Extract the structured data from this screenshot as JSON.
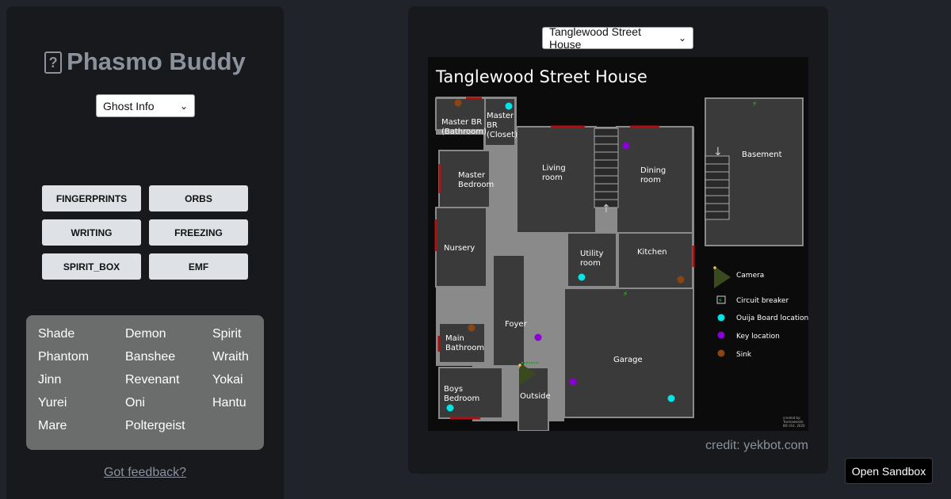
{
  "app": {
    "title": "Phasmo Buddy",
    "logo_glyph": "?"
  },
  "mode_select": {
    "value": "Ghost Info"
  },
  "evidence": [
    "FINGERPRINTS",
    "ORBS",
    "WRITING",
    "FREEZING",
    "SPIRIT_BOX",
    "EMF"
  ],
  "ghosts": [
    "Shade",
    "Demon",
    "Spirit",
    "Phantom",
    "Banshee",
    "Wraith",
    "Jinn",
    "Revenant",
    "Yokai",
    "Yurei",
    "Oni",
    "Hantu",
    "Mare",
    "Poltergeist"
  ],
  "feedback_link": "Got feedback?",
  "map_select": {
    "value": "Tanglewood Street House"
  },
  "map": {
    "title": "Tanglewood Street House",
    "rooms": {
      "master_br_bath": [
        "Master BR",
        "(Bathroom)"
      ],
      "master_br_closet": [
        "Master",
        "BR",
        "(Closet)"
      ],
      "master_bedroom": [
        "Master",
        "Bedroom"
      ],
      "living_room": [
        "Living",
        "room"
      ],
      "dining_room": [
        "Dining",
        "room"
      ],
      "nursery": "Nursery",
      "utility_room": [
        "Utility",
        "room"
      ],
      "kitchen": "Kitchen",
      "foyer": "Foyer",
      "main_bathroom": [
        "Main",
        "Bathroom"
      ],
      "garage": "Garage",
      "boys_bedroom": [
        "Boys",
        "Bedroom"
      ],
      "outside": "Outside",
      "basement": "Basement"
    },
    "legend": {
      "camera": "Camera",
      "breaker": "Circuit breaker",
      "ouija": "Ouija Board location",
      "key": "Key location",
      "sink": "Sink"
    },
    "colors": {
      "ouija": "#00e5e5",
      "key": "#8a00d4",
      "sink": "#8b4513",
      "room": "#3a3a3a",
      "wall": "#8a8a8a",
      "door": "#b01010"
    },
    "signature": [
      "created by:",
      "Tsumaweeds",
      "8th Oct. 2020"
    ]
  },
  "credit": "credit: yekbot.com",
  "sandbox_button": "Open Sandbox"
}
